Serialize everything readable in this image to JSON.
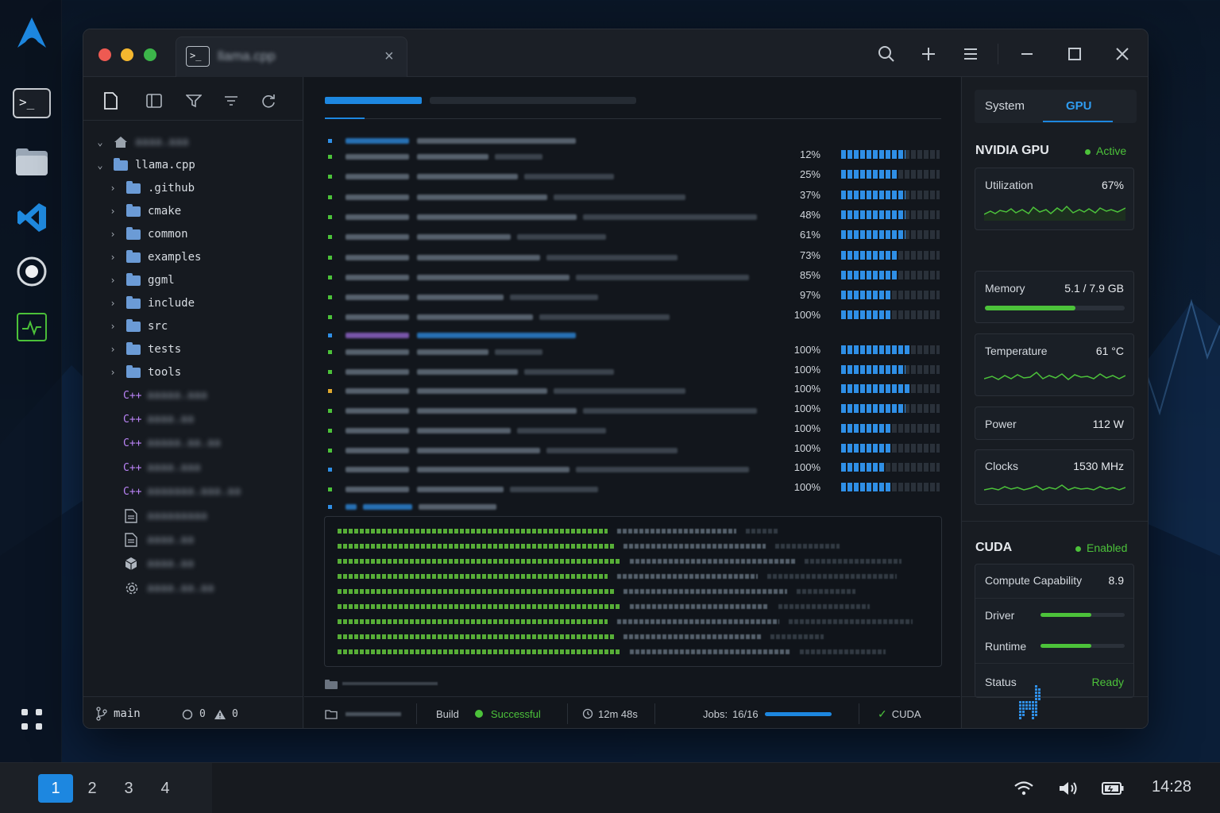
{
  "dock": {
    "items": [
      {
        "name": "terminal",
        "icon": "terminal-icon"
      },
      {
        "name": "files",
        "icon": "folder-icon"
      },
      {
        "name": "vscode",
        "icon": "vscode-icon"
      },
      {
        "name": "obs",
        "icon": "record-icon"
      },
      {
        "name": "system-monitor",
        "icon": "activity-icon"
      }
    ]
  },
  "taskbar": {
    "workspaces": [
      "1",
      "2",
      "3",
      "4"
    ],
    "active_workspace": "1",
    "clock": "14:28"
  },
  "window": {
    "tab_title": "llama.cpp"
  },
  "explorer": {
    "root_label": "llama.cpp",
    "folders": [
      ".github",
      "cmake",
      "common",
      "examples",
      "ggml",
      "include",
      "src",
      "tests",
      "tools"
    ],
    "footer": {
      "branch": "main",
      "errors": "0",
      "warnings": "0"
    }
  },
  "build": {
    "progress_rows": [
      {
        "pct": "12%",
        "fill": 0.65
      },
      {
        "pct": "25%",
        "fill": 0.58
      },
      {
        "pct": "37%",
        "fill": 0.65
      },
      {
        "pct": "48%",
        "fill": 0.65
      },
      {
        "pct": "61%",
        "fill": 0.65
      },
      {
        "pct": "73%",
        "fill": 0.58
      },
      {
        "pct": "85%",
        "fill": 0.58
      },
      {
        "pct": "97%",
        "fill": 0.52
      },
      {
        "pct": "100%",
        "fill": 0.52
      }
    ],
    "progress_rows_2": [
      {
        "pct": "100%",
        "fill": 0.71
      },
      {
        "pct": "100%",
        "fill": 0.65
      },
      {
        "pct": "100%",
        "fill": 0.71
      },
      {
        "pct": "100%",
        "fill": 0.65
      },
      {
        "pct": "100%",
        "fill": 0.52
      },
      {
        "pct": "100%",
        "fill": 0.52
      },
      {
        "pct": "100%",
        "fill": 0.45
      },
      {
        "pct": "100%",
        "fill": 0.52
      }
    ]
  },
  "statusbar": {
    "build_label": "Build",
    "build_status": "Successful",
    "duration": "12m 48s",
    "jobs_label": "Jobs:",
    "jobs_value": "16/16",
    "jobs_fill": 1.0,
    "cuda_label": "CUDA"
  },
  "right_panel": {
    "tabs": [
      "System",
      "GPU"
    ],
    "active_tab": "GPU",
    "gpu": {
      "title": "NVIDIA GPU",
      "status": "Active",
      "utilization": {
        "label": "Utilization",
        "value": "67%"
      },
      "memory": {
        "label": "Memory",
        "value": "5.1 / 7.9 GB",
        "fill": 0.65
      },
      "temperature": {
        "label": "Temperature",
        "value": "61 °C"
      },
      "power": {
        "label": "Power",
        "value": "112 W"
      },
      "clocks": {
        "label": "Clocks",
        "value": "1530 MHz"
      }
    },
    "cuda": {
      "title": "CUDA",
      "status": "Enabled",
      "compute": {
        "label": "Compute Capability",
        "value": "8.9"
      },
      "driver": {
        "label": "Driver",
        "fill": 0.6
      },
      "runtime": {
        "label": "Runtime",
        "fill": 0.6
      },
      "state": {
        "label": "Status",
        "value": "Ready"
      }
    }
  },
  "colors": {
    "accent": "#1d87e0",
    "success": "#4cc23a",
    "cpp": "#b983f5",
    "folder": "#6b9bd6"
  }
}
